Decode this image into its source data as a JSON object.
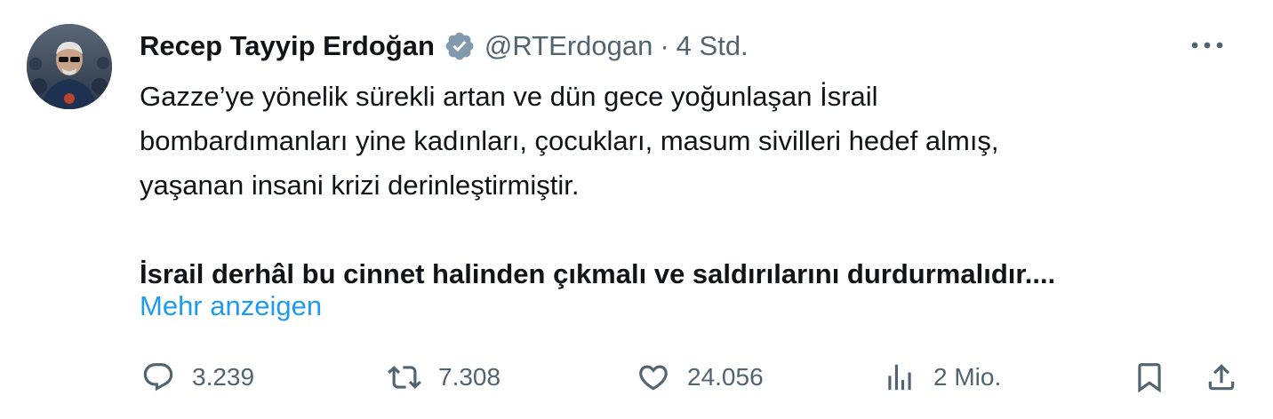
{
  "author": {
    "display_name": "Recep Tayyip Erdoğan",
    "handle": "@RTErdogan",
    "separator": "·",
    "time": "4 Std.",
    "verified_color": "#829aab"
  },
  "tweet": {
    "text": "Gazze’ye yönelik sürekli artan ve dün gece yoğunlaşan İsrail\nbombardımanları yine kadınları, çocukları, masum sivilleri hedef almış,\nyaşanan insani krizi derinleştirmiştir.",
    "bold_text": "İsrail derhâl bu cinnet halinden çıkmalı ve saldırılarını durdurmalıdır....",
    "show_more": "Mehr anzeigen"
  },
  "actions": {
    "replies": "3.239",
    "retweets": "7.308",
    "likes": "24.056",
    "views": "2 Mio."
  },
  "icons": {
    "more": "more-horizontal-icon",
    "verified": "verified-badge-icon",
    "reply": "reply-icon",
    "retweet": "retweet-icon",
    "like": "heart-icon",
    "views": "bar-chart-icon",
    "bookmark": "bookmark-icon",
    "share": "share-icon"
  },
  "colors": {
    "text": "#0f1419",
    "secondary": "#536471",
    "link": "#1d9bf0"
  }
}
